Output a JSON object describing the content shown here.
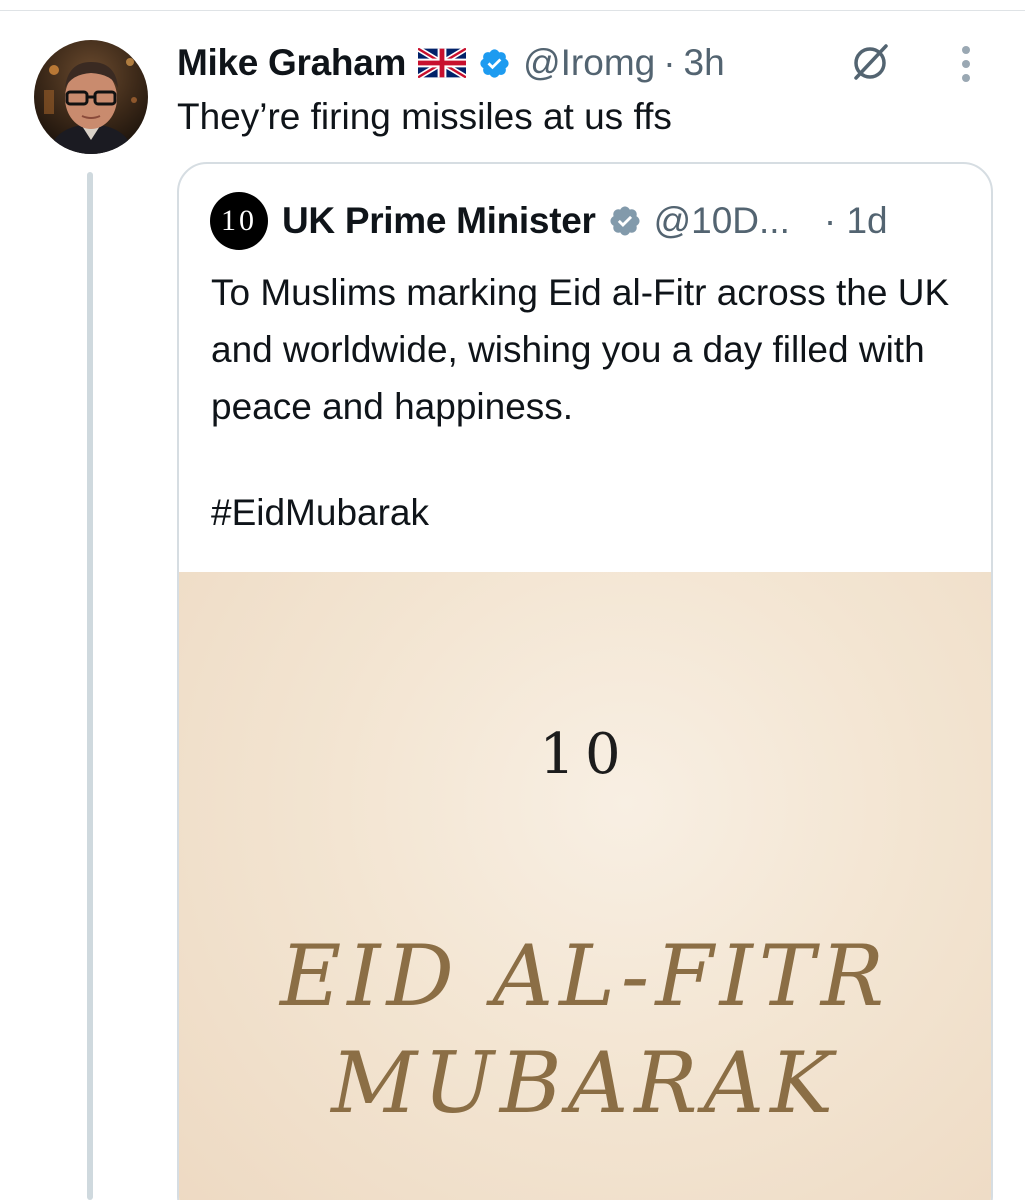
{
  "tweet": {
    "author_name": "Mike Graham",
    "author_flag": "uk-flag-icon",
    "handle": "@Iromg",
    "separator": "·",
    "time": "3h",
    "text": "They’re firing missiles at us ffs"
  },
  "quoted_tweet": {
    "avatar_text": "10",
    "author_name": "UK Prime Minister",
    "handle": "@10D...",
    "separator": "·",
    "time": "1d",
    "text": "To Muslims marking Eid al-Fitr across the UK and worldwide, wishing you a day filled with peace and happiness.",
    "hashtag": "#EidMubarak",
    "media": {
      "logo_text": "10",
      "title_line1": "EID AL-FITR",
      "title_line2": "MUBARAK"
    }
  },
  "colors": {
    "verified_blue": "#1d9bf0",
    "verified_gray": "#829aab",
    "secondary_text": "#536471",
    "media_gold": "#8b6e45"
  }
}
